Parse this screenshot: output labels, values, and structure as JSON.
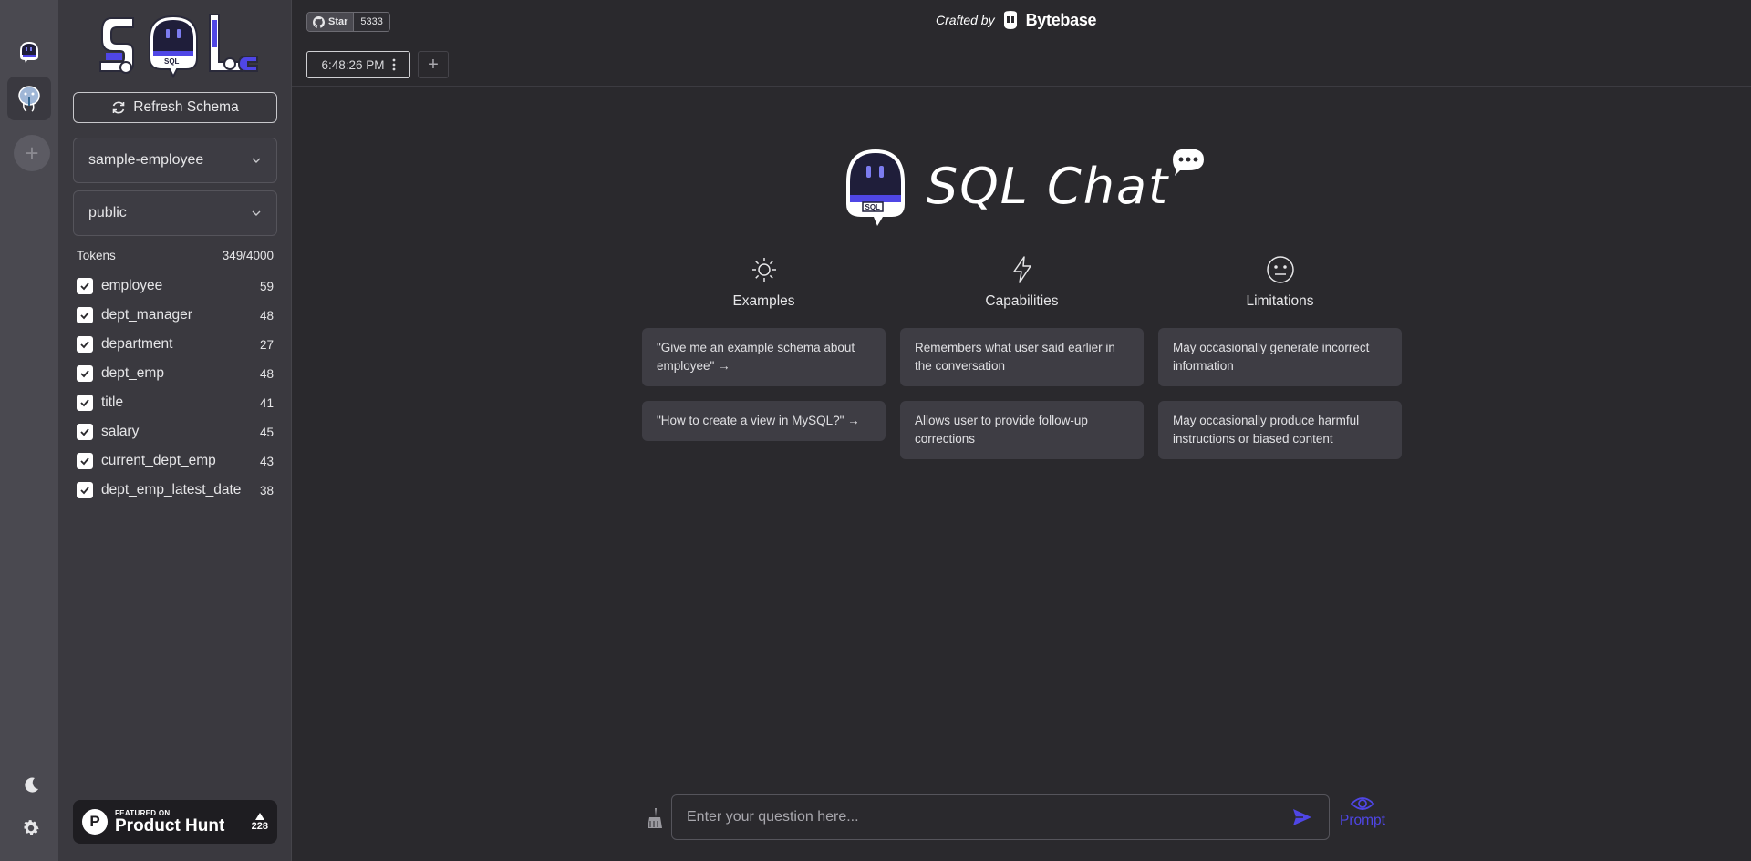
{
  "sidebar": {
    "refresh_label": "Refresh Schema",
    "database_select": "sample-employee",
    "schema_select": "public",
    "tokens_label": "Tokens",
    "tokens_value": "349/4000",
    "tables": [
      {
        "name": "employee",
        "count": "59",
        "checked": true
      },
      {
        "name": "dept_manager",
        "count": "48",
        "checked": true
      },
      {
        "name": "department",
        "count": "27",
        "checked": true
      },
      {
        "name": "dept_emp",
        "count": "48",
        "checked": true
      },
      {
        "name": "title",
        "count": "41",
        "checked": true
      },
      {
        "name": "salary",
        "count": "45",
        "checked": true
      },
      {
        "name": "current_dept_emp",
        "count": "43",
        "checked": true
      },
      {
        "name": "dept_emp_latest_date",
        "count": "38",
        "checked": true
      }
    ],
    "product_hunt": {
      "featured": "FEATURED ON",
      "name": "Product Hunt",
      "votes": "228"
    }
  },
  "header": {
    "github_star_label": "Star",
    "github_star_count": "5333",
    "crafted_by": "Crafted by",
    "brand": "Bytebase"
  },
  "tabs": [
    {
      "label": "6:48:26 PM"
    }
  ],
  "hero": {
    "title": "SQL Chat",
    "columns": [
      {
        "title": "Examples",
        "icon": "sun-icon",
        "cards": [
          "\"Give me an example schema about employee\" →",
          "\"How to create a view in MySQL?\" →"
        ]
      },
      {
        "title": "Capabilities",
        "icon": "lightning-icon",
        "cards": [
          "Remembers what user said earlier in the conversation",
          "Allows user to provide follow-up corrections"
        ]
      },
      {
        "title": "Limitations",
        "icon": "neutral-face-icon",
        "cards": [
          "May occasionally generate incorrect information",
          "May occasionally produce harmful instructions or biased content"
        ]
      }
    ]
  },
  "chat": {
    "placeholder": "Enter your question here...",
    "prompt_label": "Prompt"
  },
  "colors": {
    "accent": "#4f46e5",
    "background": "#2a292d",
    "sidebar": "#3a393f",
    "rail": "#4a4950"
  }
}
